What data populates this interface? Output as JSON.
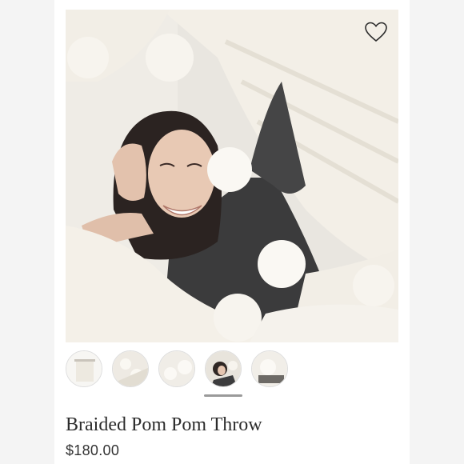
{
  "product": {
    "name": "Braided Pom Pom Throw",
    "price": "$180.00",
    "image_alt": "Smiling woman wrapped in a cream braided pom pom throw blanket",
    "favorite_icon": "heart-outline-icon"
  },
  "gallery": {
    "thumbnail_count": 5,
    "selected_index": 3,
    "thumbnails": [
      {
        "label": "Thumbnail 1"
      },
      {
        "label": "Thumbnail 2"
      },
      {
        "label": "Thumbnail 3"
      },
      {
        "label": "Thumbnail 4"
      },
      {
        "label": "Thumbnail 5"
      }
    ]
  },
  "colors": {
    "page_background": "#f4f4f4",
    "card_background": "#ffffff",
    "text_primary": "#2c2c2c",
    "selection_indicator": "#9a9a9a",
    "throw_cream": "#f1ede5"
  }
}
